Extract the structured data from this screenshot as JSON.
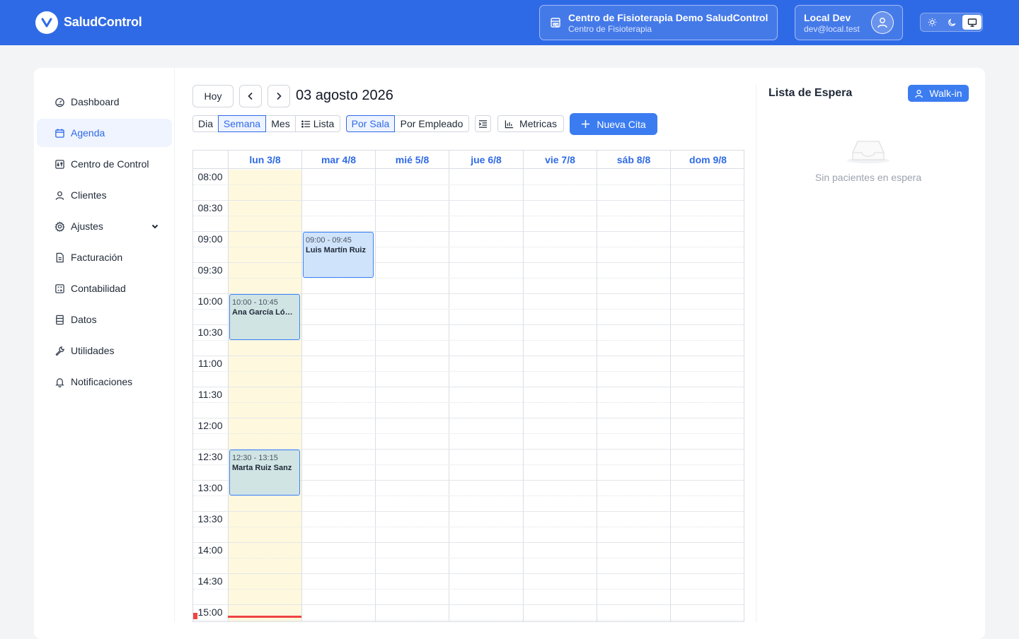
{
  "header": {
    "brand": "SaludControl",
    "org_name": "Centro de Fisioterapia Demo SaludControl",
    "org_type": "Centro de Fisioterapia",
    "user_name": "Local Dev",
    "user_email": "dev@local.test",
    "theme_options": [
      "light",
      "dark",
      "system"
    ],
    "theme_selected": "system"
  },
  "sidebar": {
    "items": [
      {
        "label": "Dashboard",
        "icon": "gauge-icon"
      },
      {
        "label": "Agenda",
        "icon": "calendar-icon",
        "active": true
      },
      {
        "label": "Centro de Control",
        "icon": "sliders-icon"
      },
      {
        "label": "Clientes",
        "icon": "user-icon"
      },
      {
        "label": "Ajustes",
        "icon": "gear-icon",
        "expandable": true
      },
      {
        "label": "Facturación",
        "icon": "invoice-icon"
      },
      {
        "label": "Contabilidad",
        "icon": "calculator-icon"
      },
      {
        "label": "Datos",
        "icon": "database-icon"
      },
      {
        "label": "Utilidades",
        "icon": "wrench-icon"
      },
      {
        "label": "Notificaciones",
        "icon": "bell-icon"
      }
    ]
  },
  "toolbar": {
    "today_label": "Hoy",
    "date_title": "03 agosto 2026",
    "views": [
      "Dia",
      "Semana",
      "Mes",
      "Lista"
    ],
    "active_view": "Semana",
    "groupings": [
      "Por Sala",
      "Por Empleado"
    ],
    "active_grouping": "Por Sala",
    "metrics_label": "Metricas",
    "new_label": "Nueva Cita"
  },
  "calendar": {
    "days": [
      "lun 3/8",
      "mar 4/8",
      "mié 5/8",
      "jue 6/8",
      "vie 7/8",
      "sáb 8/8",
      "dom 9/8"
    ],
    "today_index": 0,
    "times": [
      "08:00",
      "08:30",
      "09:00",
      "09:30",
      "10:00",
      "10:30",
      "11:00",
      "11:30",
      "12:00",
      "12:30",
      "13:00",
      "13:30",
      "14:00",
      "14:30",
      "15:00"
    ],
    "events": [
      {
        "time": "09:00 - 09:45",
        "name": "Luis Martín Ruiz",
        "day": 1,
        "start": "09:00",
        "end": "09:45",
        "color": "#cfe3fb"
      },
      {
        "time": "10:00 - 10:45",
        "name": "Ana García López",
        "day": 0,
        "start": "10:00",
        "end": "10:45",
        "color": "#d0e4e4"
      },
      {
        "time": "12:30 - 13:15",
        "name": "Marta Ruiz Sanz",
        "day": 0,
        "start": "12:30",
        "end": "13:15",
        "color": "#d0e4e4"
      }
    ]
  },
  "waitlist": {
    "title": "Lista de Espera",
    "walkin_label": "Walk-in",
    "empty_text": "Sin pacientes en espera"
  },
  "colors": {
    "primary": "#2f6ae6",
    "button": "#3b7cf0",
    "today_bg": "#fef9de",
    "now_line": "#ef4444"
  }
}
